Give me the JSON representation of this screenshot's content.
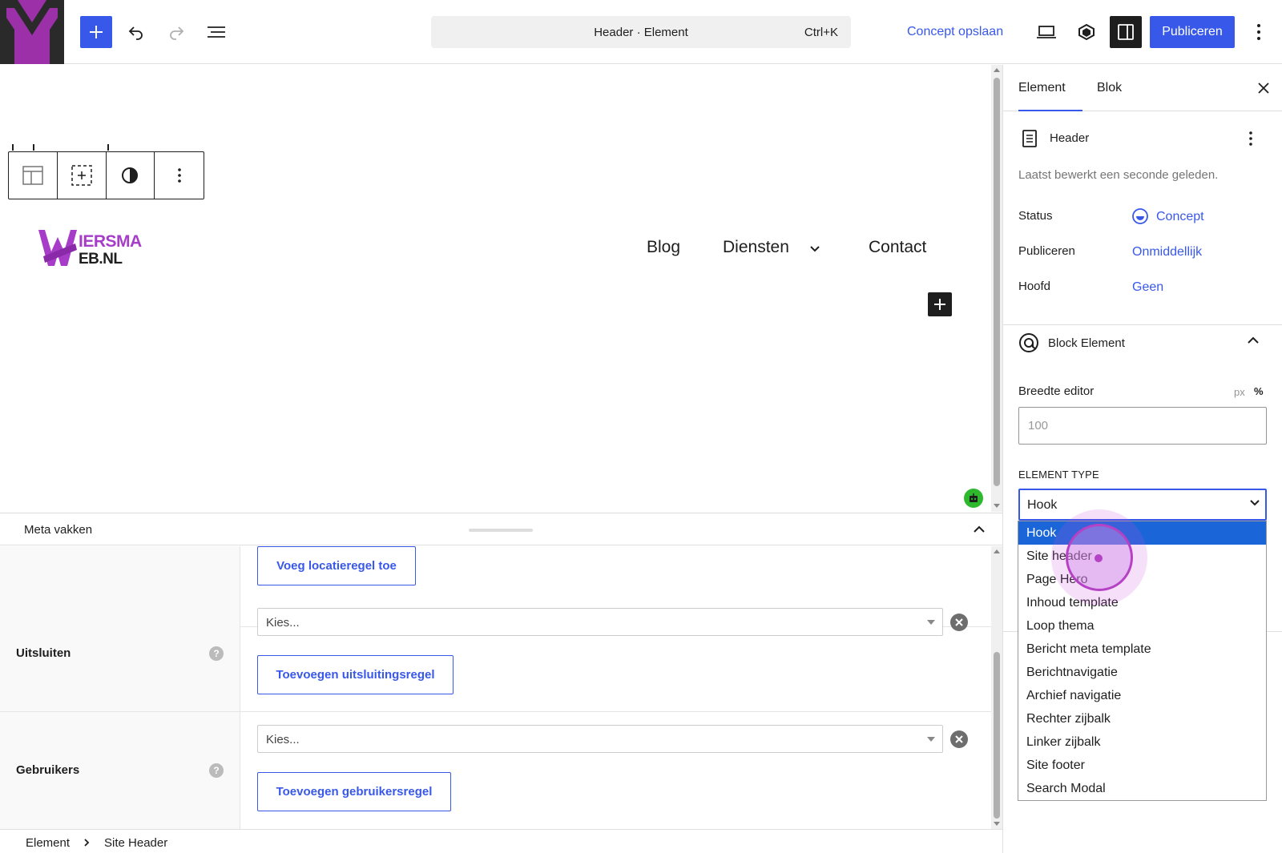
{
  "topbar": {
    "document_title": "Header · Element",
    "shortcut": "Ctrl+K",
    "save_draft_label": "Concept opslaan",
    "publish_label": "Publiceren"
  },
  "canvas": {
    "site_logo_text_top": "IERSMA",
    "site_logo_text_bottom": "EB.NL",
    "nav_items": [
      "Blog",
      "Diensten",
      "Contact"
    ]
  },
  "meta_boxes": {
    "title": "Meta vakken",
    "add_location_label": "Voeg locatieregel toe",
    "rows": [
      {
        "label": "Uitsluiten",
        "select_placeholder": "Kies...",
        "button_label": "Toevoegen uitsluitingsregel"
      },
      {
        "label": "Gebruikers",
        "select_placeholder": "Kies...",
        "button_label": "Toevoegen gebruikersregel"
      }
    ],
    "help_glyph": "?"
  },
  "breadcrumb": [
    "Element",
    "Site Header"
  ],
  "sidebar": {
    "tabs": [
      "Element",
      "Blok"
    ],
    "doc_title": "Header",
    "last_edited": "Laatst bewerkt een seconde geleden.",
    "status_label": "Status",
    "status_value": "Concept",
    "publish_label": "Publiceren",
    "publish_value": "Onmiddellijk",
    "parent_label": "Hoofd",
    "parent_value": "Geen",
    "panel_title": "Block Element",
    "width_label": "Breedte editor",
    "unit_px": "px",
    "unit_pct": "%",
    "width_placeholder": "100",
    "element_type_label": "ELEMENT TYPE",
    "element_type_value": "Hook"
  },
  "dropdown": {
    "options": [
      "Hook",
      "Site header",
      "Page Hero",
      "Inhoud template",
      "Loop thema",
      "Bericht meta template",
      "Berichtnavigatie",
      "Archief navigatie",
      "Rechter zijbalk",
      "Linker zijbalk",
      "Site footer",
      "Search Modal"
    ],
    "selected_index": 0
  },
  "colors": {
    "accent": "#3858e9",
    "wp_logo_bg": "#9b30a8",
    "option_selected": "#1a66d8",
    "click_highlight": "#b542c4"
  }
}
